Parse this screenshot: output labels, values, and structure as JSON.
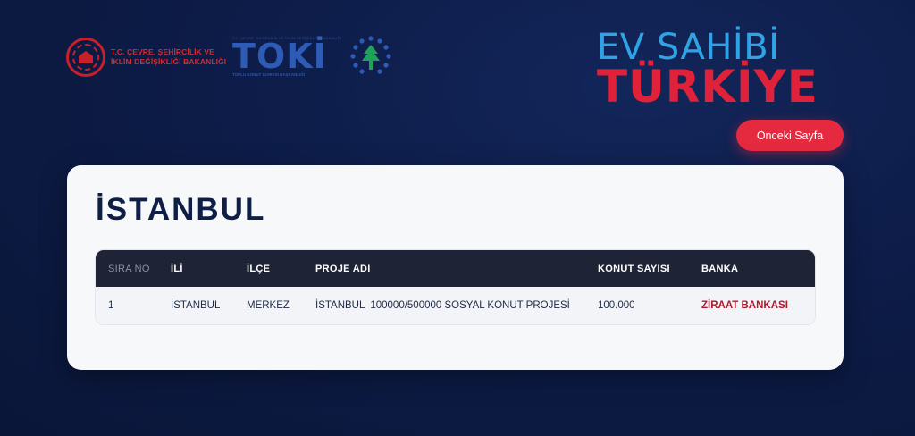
{
  "header": {
    "bakanlik": {
      "line1": "T.C. ÇEVRE, ŞEHİRCİLİK VE",
      "line2": "İKLİM DEĞİŞİKLİĞİ BAKANLIĞI"
    },
    "toki": {
      "top_small": "T.C. ÇEVRE, ŞEHİRCİLİK VE İKLİM DEĞİŞİKLİĞİ BAKANLIĞI",
      "name": "TOKİ",
      "subtitle": "TOPLU KONUT İDARESİ BAŞKANLIĞI"
    },
    "brand": {
      "top": "EV SAHİBİ",
      "bottom": "TÜRKİYE"
    },
    "prev_button_label": "Önceki Sayfa"
  },
  "card": {
    "title": "İSTANBUL",
    "table": {
      "headers": [
        "SIRA NO",
        "İLİ",
        "İLÇE",
        "PROJE ADI",
        "KONUT SAYISI",
        "BANKA"
      ],
      "rows": [
        [
          "1",
          "İSTANBUL",
          "MERKEZ",
          "İSTANBUL  100000/500000 SOSYAL KONUT PROJESİ",
          "100.000",
          "ZİRAAT BANKASI"
        ]
      ]
    }
  },
  "colors": {
    "background": "#0d1c48",
    "accent_red": "#e52a40",
    "brand_blue": "#2fa3e6",
    "table_header": "#1e2436",
    "bank_text": "#b0192c"
  }
}
